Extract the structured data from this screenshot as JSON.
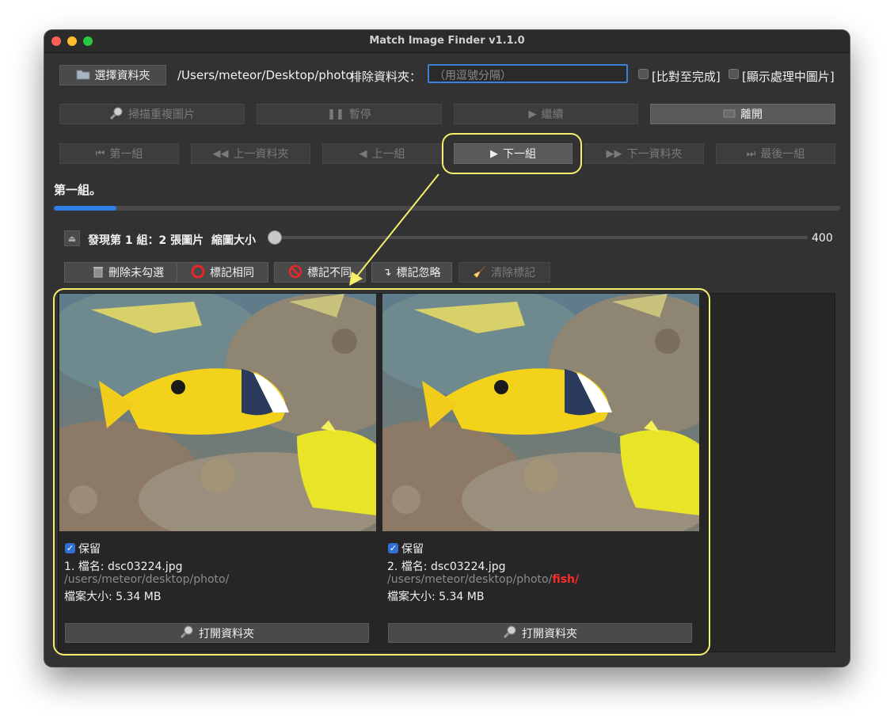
{
  "window": {
    "title": "Match Image Finder v1.1.0"
  },
  "toolbar1": {
    "select_folder": "選擇資料夾",
    "path": "/Users/meteor/Desktop/photo",
    "exclude_label": "排除資料夾：",
    "exclude_placeholder": "（用逗號分隔）",
    "check_compare_label": "[比對至完成]",
    "check_show_label": "[顯示處理中圖片]"
  },
  "toolbar2": {
    "scan": "掃描重複圖片",
    "pause": "暫停",
    "resume": "繼續",
    "leave": "離開"
  },
  "nav": {
    "first": "第一組",
    "prev_folder": "上一資料夾",
    "prev": "上一組",
    "next": "下一組",
    "next_folder": "下一資料夾",
    "last": "最後一組"
  },
  "status": {
    "text": "第一組。",
    "progress": 0.08
  },
  "group": {
    "info": "發現第 1 組：2 張圖片",
    "thumb_label": "縮圖大小",
    "thumb_value": "400",
    "thumb_level": 0.0
  },
  "actions": {
    "delete_unchecked": "刪除未勾選",
    "mark_same": "標記相同",
    "mark_diff": "標記不同",
    "mark_ignore": "標記忽略",
    "clear_marks": "清除標記"
  },
  "images": [
    {
      "keep_label": "保留",
      "keep": true,
      "name": "1. 檔名: dsc03224.jpg",
      "path": "/users/meteor/desktop/photo/",
      "path_extra": "",
      "size": "檔案大小: 5.34 MB",
      "open_label": "打開資料夾"
    },
    {
      "keep_label": "保留",
      "keep": true,
      "name": "2. 檔名: dsc03224.jpg",
      "path": "/users/meteor/desktop/photo/",
      "path_extra": "fish/",
      "size": "檔案大小: 5.34 MB",
      "open_label": "打開資料夾"
    }
  ],
  "colors": {
    "accent": "#2f7ee8",
    "highlight": "#f4f06a",
    "path_highlight": "#ff2a2a"
  },
  "icons": [
    "folder-icon",
    "magnifier-icon",
    "pause-icon",
    "play-icon",
    "exit-icon",
    "first-icon",
    "rewind-icon",
    "back-icon",
    "forward-icon",
    "last-icon",
    "eject-icon",
    "trash-icon",
    "circle-icon",
    "no-icon",
    "return-icon",
    "broom-icon",
    "search-icon"
  ]
}
